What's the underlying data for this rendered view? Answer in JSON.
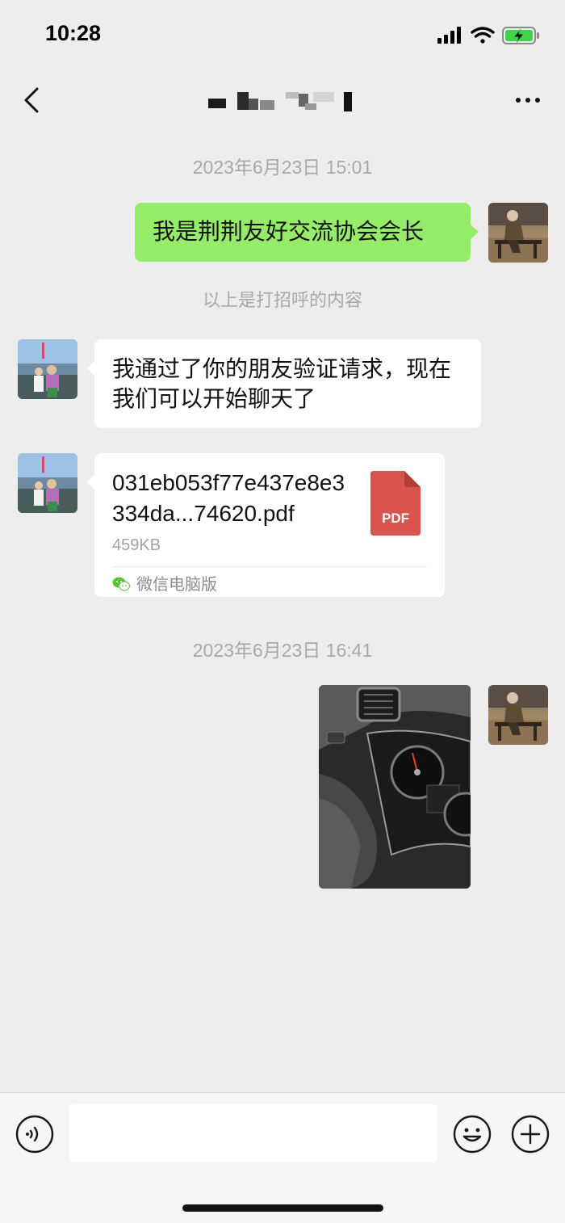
{
  "status_bar": {
    "time": "10:28"
  },
  "nav": {
    "title_obscured": true
  },
  "messages": {
    "timestamp_1": "2023年6月23日 15:01",
    "outgoing_1": "我是荆荆友好交流协会会长",
    "system_1": "以上是打招呼的内容",
    "incoming_1": "我通过了你的朋友验证请求，现在我们可以开始聊天了",
    "file": {
      "name": "031eb053f77e437e8e3334da...74620.pdf",
      "size": "459KB",
      "type_label": "PDF",
      "source": "微信电脑版"
    },
    "timestamp_2": "2023年6月23日 16:41"
  },
  "colors": {
    "background": "#ededed",
    "outgoing_bubble": "#95ec69",
    "incoming_bubble": "#ffffff",
    "pdf_red": "#d9534f",
    "timestamp_text": "#a8a8a8"
  },
  "input": {
    "value": "",
    "placeholder": ""
  }
}
